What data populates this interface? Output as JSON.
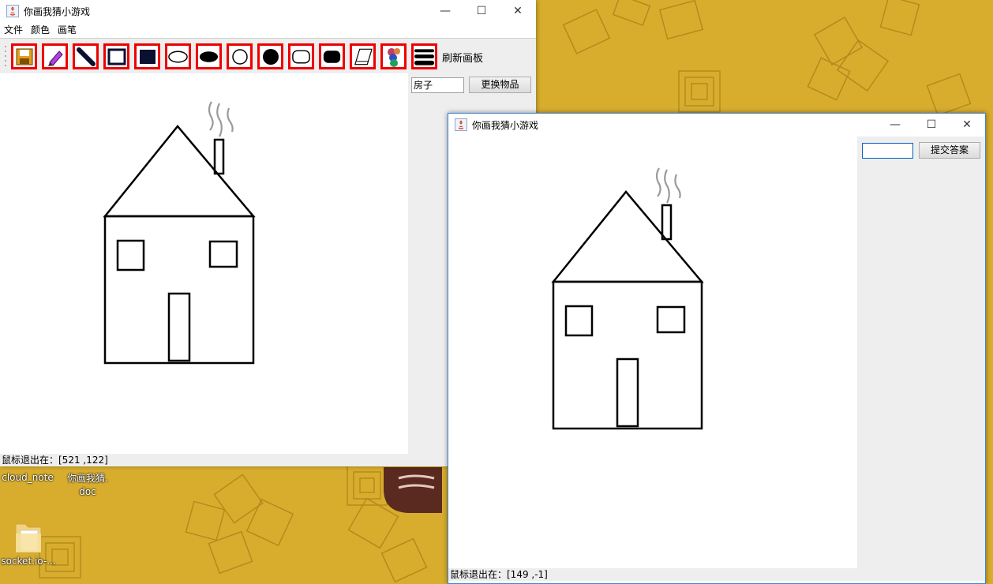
{
  "desktop": {
    "icons": [
      {
        "label": "cloud_note"
      },
      {
        "label_line1": "你画我猜.",
        "label_line2": "doc"
      },
      {
        "label": "socket.io-..."
      }
    ]
  },
  "drawer_window": {
    "title": "你画我猜小游戏",
    "controls": {
      "minimize": "—",
      "maximize": "☐",
      "close": "✕"
    },
    "menu": [
      "文件",
      "颜色",
      "画笔"
    ],
    "tools": [
      "save",
      "pencil",
      "line",
      "rectangle",
      "filled-rectangle",
      "oval",
      "filled-oval",
      "circle",
      "filled-circle",
      "round-rectangle",
      "filled-round-rectangle",
      "eraser",
      "color-palette",
      "stroke-width"
    ],
    "refresh_label": "刷新画板",
    "word_value": "房子",
    "change_button": "更换物品",
    "status": "鼠标退出在：[521 ,122]"
  },
  "guesser_window": {
    "title": "你画我猜小游戏",
    "controls": {
      "minimize": "—",
      "maximize": "☐",
      "close": "✕"
    },
    "answer_value": "",
    "submit_button": "提交答案",
    "status": "鼠标退出在：[149 ,-1]"
  },
  "colors": {
    "accent_red": "#ee0000",
    "desktop_bg": "#d8ad2d",
    "panel": "#eeeeee"
  }
}
